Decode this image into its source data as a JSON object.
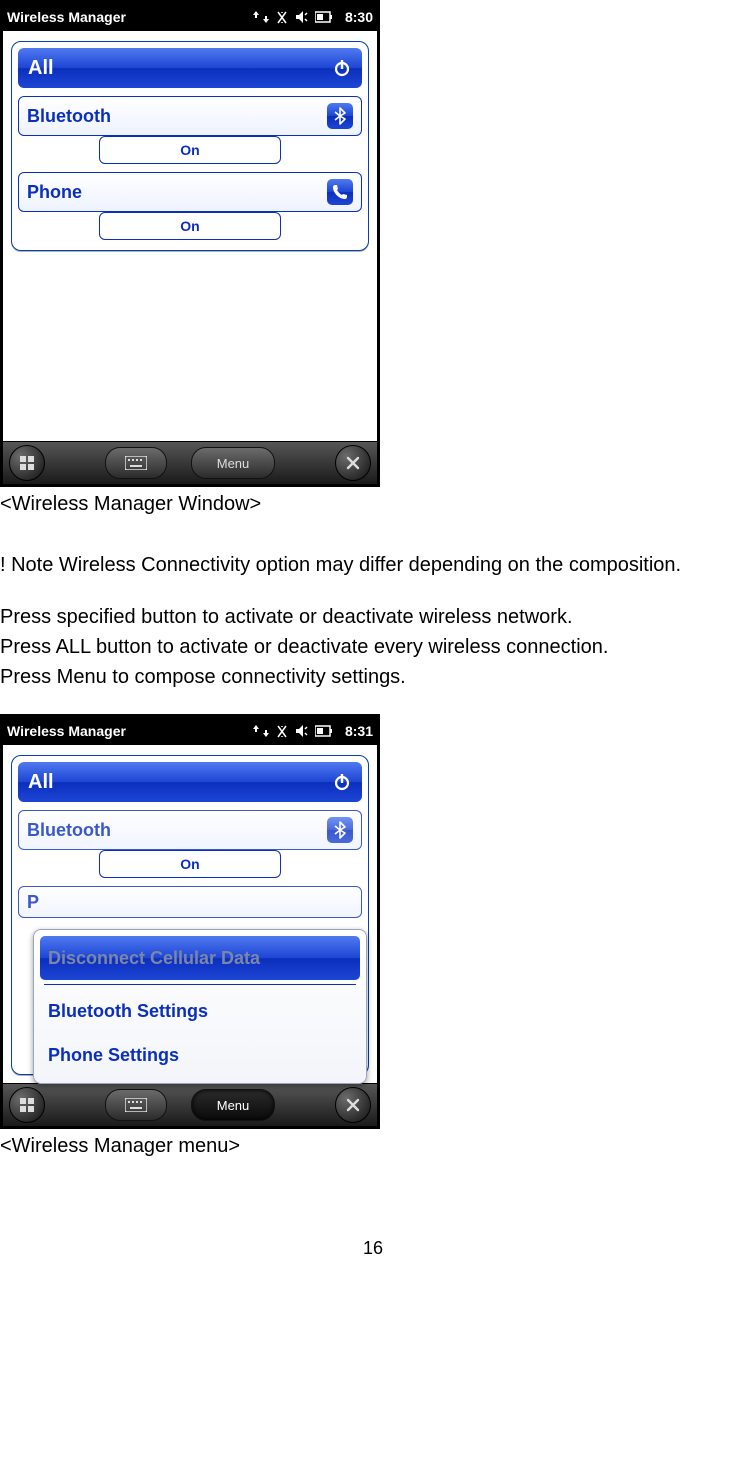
{
  "page_number": "16",
  "screenshot1": {
    "title": "Wireless Manager",
    "time": "8:30",
    "all_label": "All",
    "items": [
      {
        "name": "Bluetooth",
        "status": "On",
        "icon": "bluetooth"
      },
      {
        "name": "Phone",
        "status": "On",
        "icon": "phone"
      }
    ],
    "menu_button": "Menu"
  },
  "caption1": "<Wireless Manager Window>",
  "note": "! Note Wireless Connectivity option may differ depending on the composition.",
  "instructions": [
    "Press specified button to activate or deactivate wireless network.",
    "Press ALL button to activate or deactivate every wireless connection.",
    "Press Menu to compose connectivity settings."
  ],
  "screenshot2": {
    "title": "Wireless Manager",
    "time": "8:31",
    "all_label": "All",
    "items": [
      {
        "name": "Bluetooth",
        "status": "On",
        "icon": "bluetooth"
      }
    ],
    "partial_item_letter": "P",
    "menu_button": "Menu",
    "menu_items": [
      {
        "label": "Disconnect Cellular Data",
        "selected": true,
        "disabled": true
      },
      {
        "label": "Bluetooth Settings",
        "selected": false,
        "disabled": false
      },
      {
        "label": "Phone Settings",
        "selected": false,
        "disabled": false
      }
    ]
  },
  "caption2": "<Wireless Manager menu>"
}
